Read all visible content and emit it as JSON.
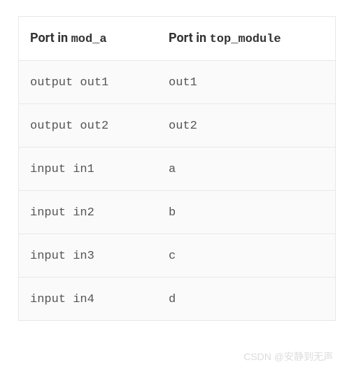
{
  "table": {
    "headers": {
      "col1_prefix": "Port in ",
      "col1_code": "mod_a",
      "col2_prefix": "Port in ",
      "col2_code": "top_module"
    },
    "rows": [
      {
        "col1": "output out1",
        "col2": "out1"
      },
      {
        "col1": "output out2",
        "col2": "out2"
      },
      {
        "col1": "input in1",
        "col2": "a"
      },
      {
        "col1": "input in2",
        "col2": "b"
      },
      {
        "col1": "input in3",
        "col2": "c"
      },
      {
        "col1": "input in4",
        "col2": "d"
      }
    ]
  },
  "watermark": "CSDN @安静到无声"
}
